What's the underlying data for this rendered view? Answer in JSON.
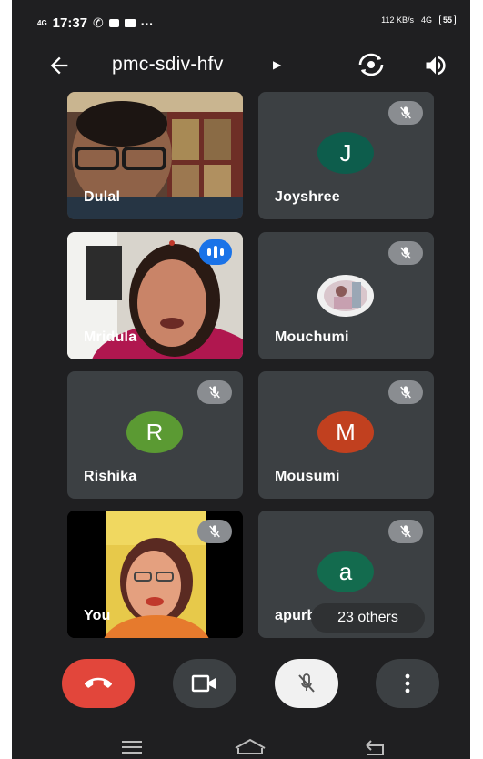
{
  "status": {
    "time": "17:37",
    "network_left": "4G",
    "speed": "112 KB/s",
    "network_right": "4G",
    "battery": "55"
  },
  "meeting": {
    "code": "pmc-sdiv-hfv"
  },
  "participants": [
    {
      "name": "Dulal",
      "type": "video",
      "muted": false
    },
    {
      "name": "Joyshree",
      "type": "avatar",
      "initial": "J",
      "color": "#0d5d4c",
      "muted": true
    },
    {
      "name": "Mridula",
      "type": "video",
      "muted": false,
      "speaking": true
    },
    {
      "name": "Mouchumi",
      "type": "photo",
      "muted": true
    },
    {
      "name": "Rishika",
      "type": "avatar",
      "initial": "R",
      "color": "#5b9a33",
      "muted": true
    },
    {
      "name": "Mousumi",
      "type": "avatar",
      "initial": "M",
      "color": "#c1401f",
      "muted": true
    },
    {
      "name": "You",
      "type": "video",
      "muted": true
    },
    {
      "name": "apurb",
      "type": "avatar",
      "initial": "a",
      "color": "#136b4e",
      "muted": true
    }
  ],
  "others_label": "23 others",
  "colors": {
    "end_call": "#e2463b",
    "background": "#1f1f21",
    "tile": "#3c4043",
    "control": "#3c4043"
  }
}
